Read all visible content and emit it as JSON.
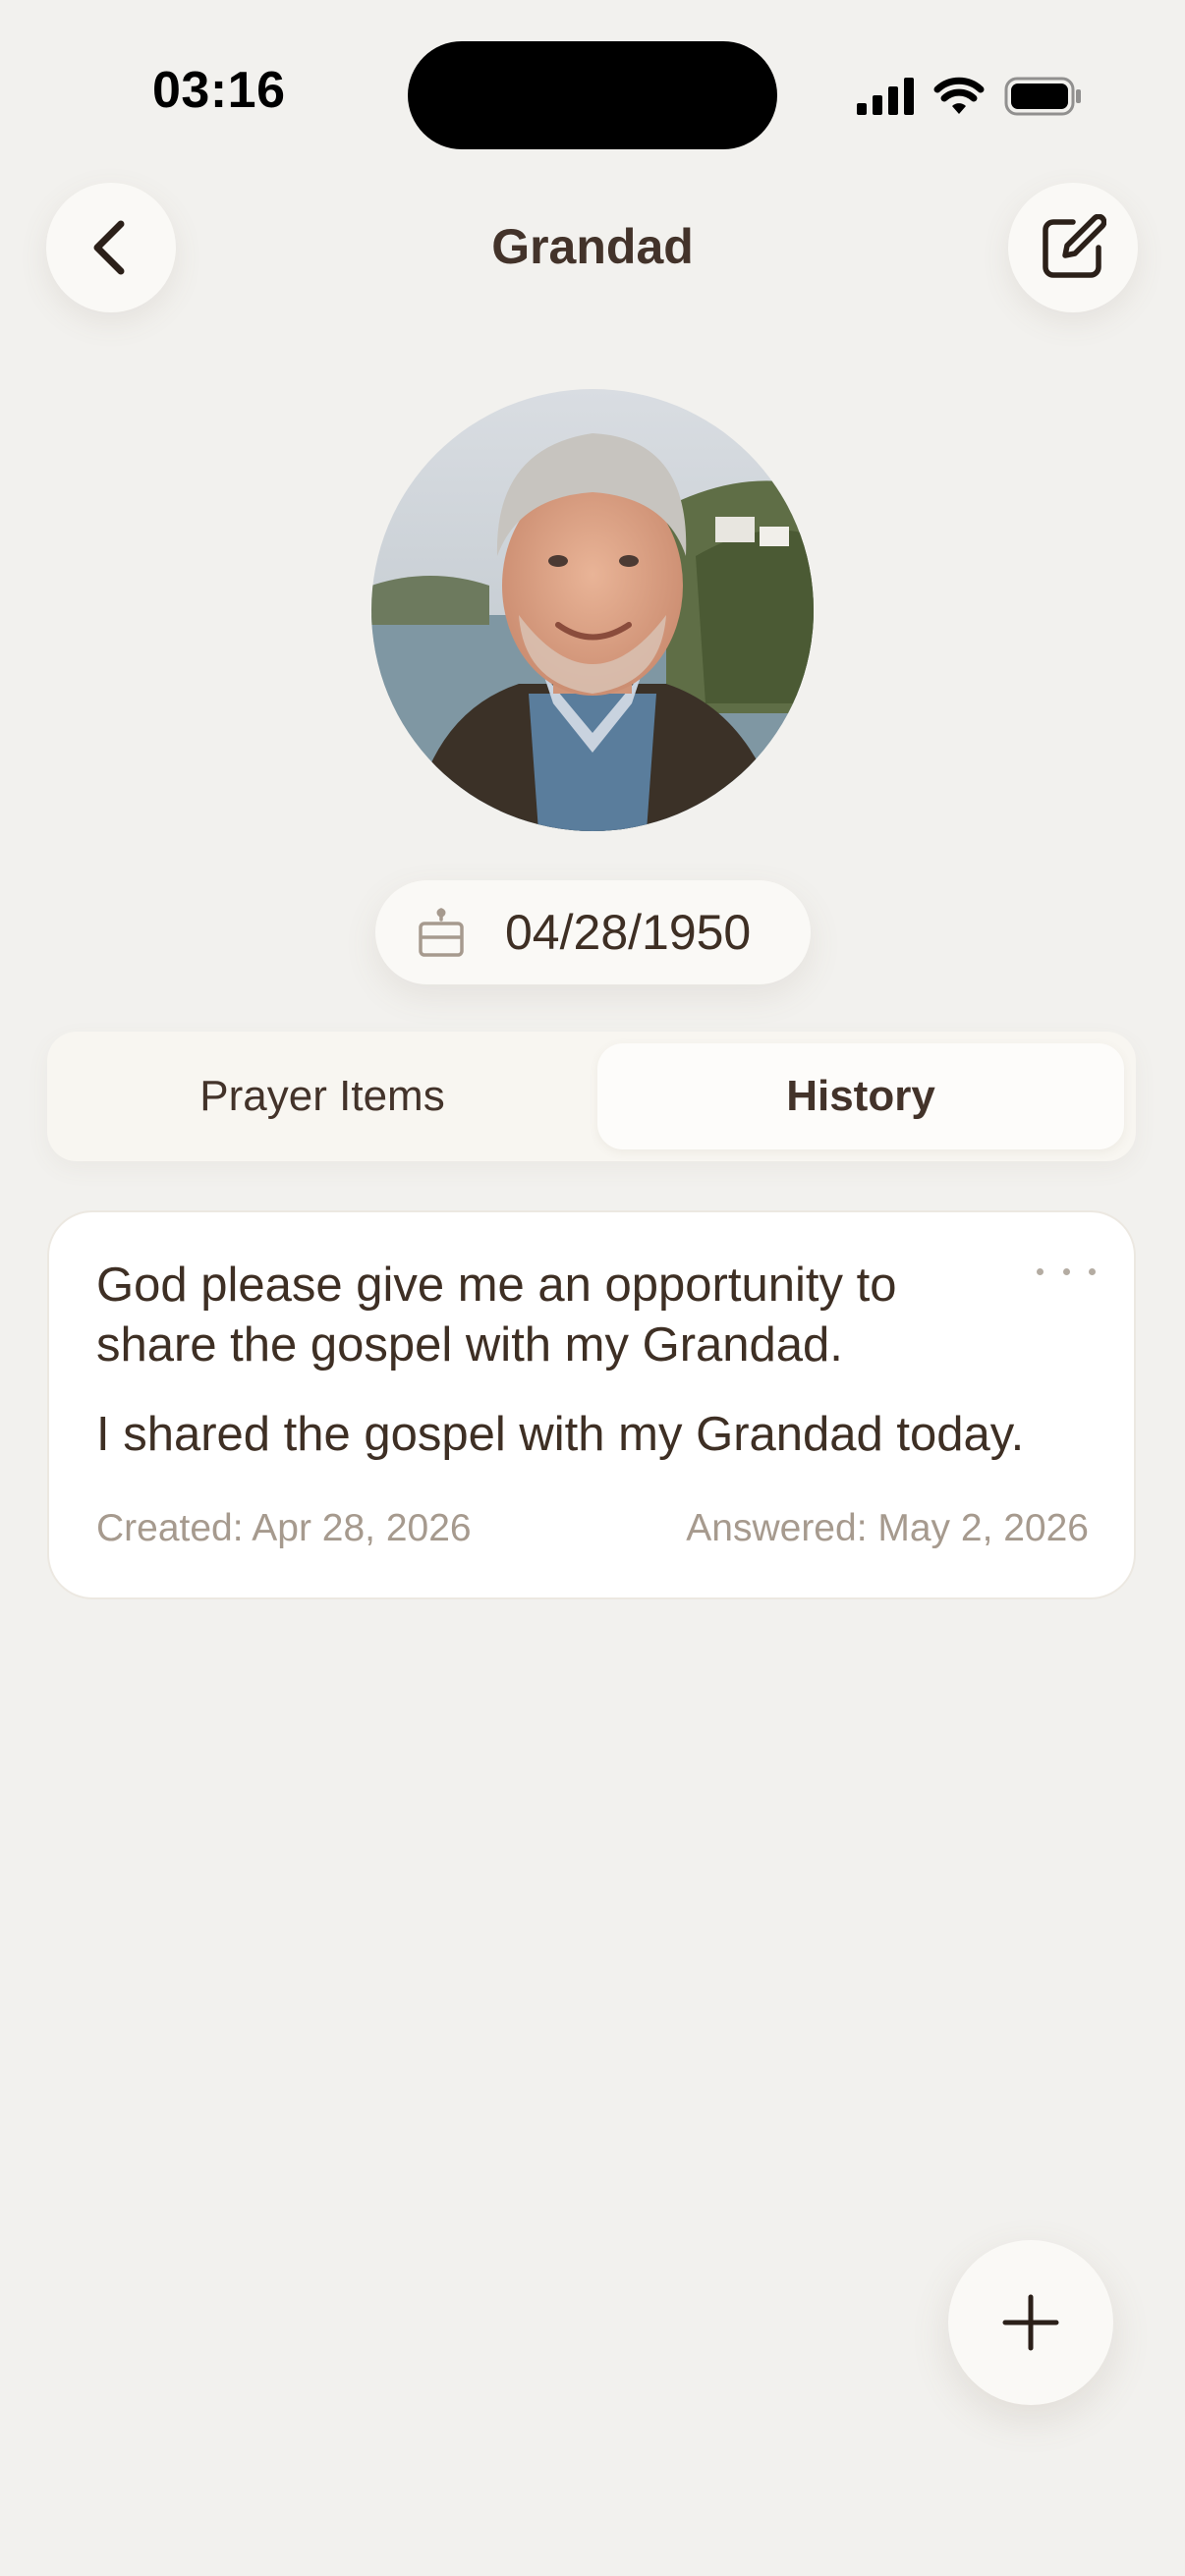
{
  "status_bar": {
    "time": "03:16",
    "icons": [
      "cellular-signal-icon",
      "wifi-icon",
      "battery-icon"
    ]
  },
  "header": {
    "title": "Grandad",
    "back_icon": "chevron-left-icon",
    "edit_icon": "edit-square-icon"
  },
  "profile": {
    "photo_description": "portrait photo",
    "birthday_icon": "birthday-cake-icon",
    "birthday": "04/28/1950"
  },
  "tabs": {
    "items": [
      {
        "label": "Prayer Items",
        "selected": false
      },
      {
        "label": "History",
        "selected": true
      }
    ]
  },
  "history": {
    "items": [
      {
        "request": "God please give me an opportunity to share the gospel with my Grandad.",
        "answer": "I shared the gospel with my Grandad today.",
        "created": "Created: Apr 28, 2026",
        "answered": "Answered: May 2, 2026",
        "menu_icon": "more-horizontal-icon"
      }
    ]
  },
  "fab": {
    "icon": "plus-icon"
  },
  "colors": {
    "background": "#f2f1ee",
    "surface": "#faf9f6",
    "text_primary": "#3e2f24",
    "text_muted": "#a69a8e"
  }
}
